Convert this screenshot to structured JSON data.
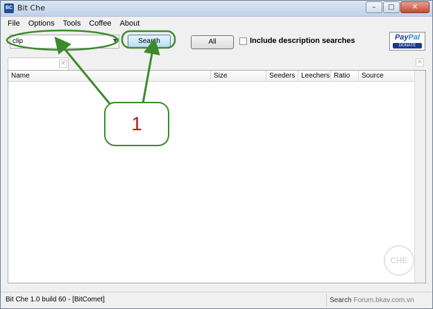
{
  "window": {
    "app_icon": "BC",
    "title": "Bit Che",
    "controls": {
      "minimize": "–",
      "maximize": "□",
      "close": "✕"
    }
  },
  "menu": [
    "File",
    "Options",
    "Tools",
    "Coffee",
    "About"
  ],
  "toolbar": {
    "search_value": "clip",
    "search_button": "Search",
    "all_button": "All",
    "include_description_label": "Include description searches",
    "include_description_checked": false,
    "paypal": {
      "logo_main": "Pay",
      "logo_accent": "Pal",
      "donate": "DONATE"
    }
  },
  "tabs": {
    "close_glyph": "✕"
  },
  "results": {
    "columns": [
      "Name",
      "Size",
      "Seeders",
      "Leechers",
      "Ratio",
      "Source"
    ],
    "rows": []
  },
  "watermark_text": "CHE",
  "statusbar": {
    "left": "Bit Che  1.0 build 60  -  [BitComet]",
    "right_label": "Search",
    "right_watermark": "Forum.bkav.com.vn"
  },
  "annotation": {
    "callout_number": "1"
  },
  "colors": {
    "annotation_green": "#3d8a2c",
    "callout_number": "#c01a1a",
    "search_button": "#b7dcf5"
  }
}
